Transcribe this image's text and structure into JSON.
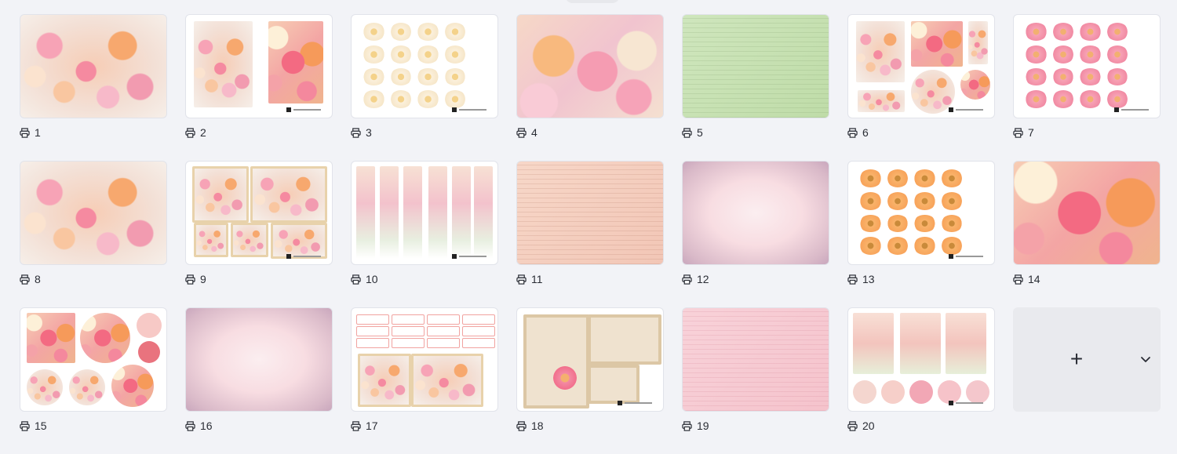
{
  "pages": [
    {
      "number": "1",
      "style": "floral"
    },
    {
      "number": "2",
      "style": "sheet-two-panels"
    },
    {
      "number": "3",
      "style": "sheet-cream-flowers"
    },
    {
      "number": "4",
      "style": "floral-big"
    },
    {
      "number": "5",
      "style": "green-paper"
    },
    {
      "number": "6",
      "style": "sheet-tags"
    },
    {
      "number": "7",
      "style": "sheet-pink-flowers"
    },
    {
      "number": "8",
      "style": "floral"
    },
    {
      "number": "9",
      "style": "sheet-frames"
    },
    {
      "number": "10",
      "style": "sheet-bookmarks"
    },
    {
      "number": "11",
      "style": "peach-paper"
    },
    {
      "number": "12",
      "style": "vignette"
    },
    {
      "number": "13",
      "style": "sheet-orange-flowers"
    },
    {
      "number": "14",
      "style": "floral-14"
    },
    {
      "number": "15",
      "style": "sheet-circles"
    },
    {
      "number": "16",
      "style": "vignette"
    },
    {
      "number": "17",
      "style": "sheet-sentiments"
    },
    {
      "number": "18",
      "style": "sheet-frames-18"
    },
    {
      "number": "19",
      "style": "pink-paper"
    },
    {
      "number": "20",
      "style": "sheet-20"
    }
  ],
  "add_page": {
    "plus_icon": "plus-icon",
    "chevron_icon": "chevron-down-icon"
  },
  "colors": {
    "background": "#f2f3f7",
    "tile_border": "#e1e3ea",
    "text": "#2a2d35"
  }
}
